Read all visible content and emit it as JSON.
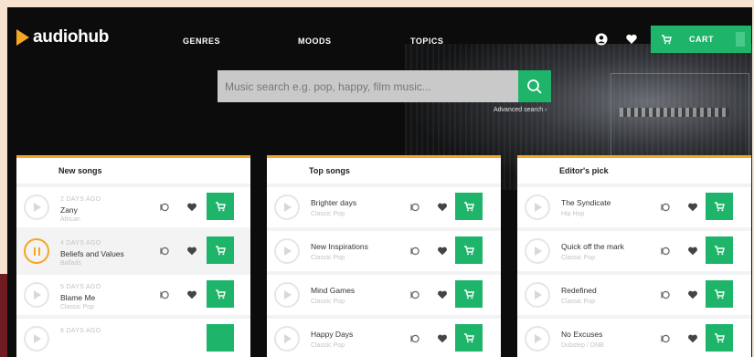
{
  "brand": {
    "name": "audiohub",
    "accent": "#f5a623",
    "green": "#1eb56a"
  },
  "nav": {
    "genres": "GENRES",
    "moods": "MOODS",
    "topics": "TOPICS"
  },
  "header": {
    "cart_label": "CART"
  },
  "search": {
    "placeholder": "Music search e.g. pop, happy, film music...",
    "advanced": "Advanced search ›"
  },
  "sections": {
    "new_songs": {
      "title": "New songs",
      "items": [
        {
          "when": "2 DAYS AGO",
          "title": "Zany",
          "genre": "African"
        },
        {
          "when": "4 DAYS AGO",
          "title": "Beliefs and Values",
          "genre": "Ballads"
        },
        {
          "when": "5 DAYS AGO",
          "title": "Blame Me",
          "genre": "Classic Pop"
        },
        {
          "when": "6 DAYS AGO"
        }
      ]
    },
    "top_songs": {
      "title": "Top songs",
      "items": [
        {
          "title": "Brighter days",
          "genre": "Classic Pop"
        },
        {
          "title": "New Inspirations",
          "genre": "Classic Pop"
        },
        {
          "title": "Mind Games",
          "genre": "Classic Pop"
        },
        {
          "title": "Happy Days",
          "genre": "Classic Pop"
        }
      ]
    },
    "editors_pick": {
      "title": "Editor's pick",
      "items": [
        {
          "title": "The Syndicate",
          "genre": "Hip Hop"
        },
        {
          "title": "Quick off the mark",
          "genre": "Classic Pop"
        },
        {
          "title": "Redefined",
          "genre": "Classic Pop"
        },
        {
          "title": "No Excuses",
          "genre": "Dubstep / DNB"
        }
      ]
    }
  }
}
